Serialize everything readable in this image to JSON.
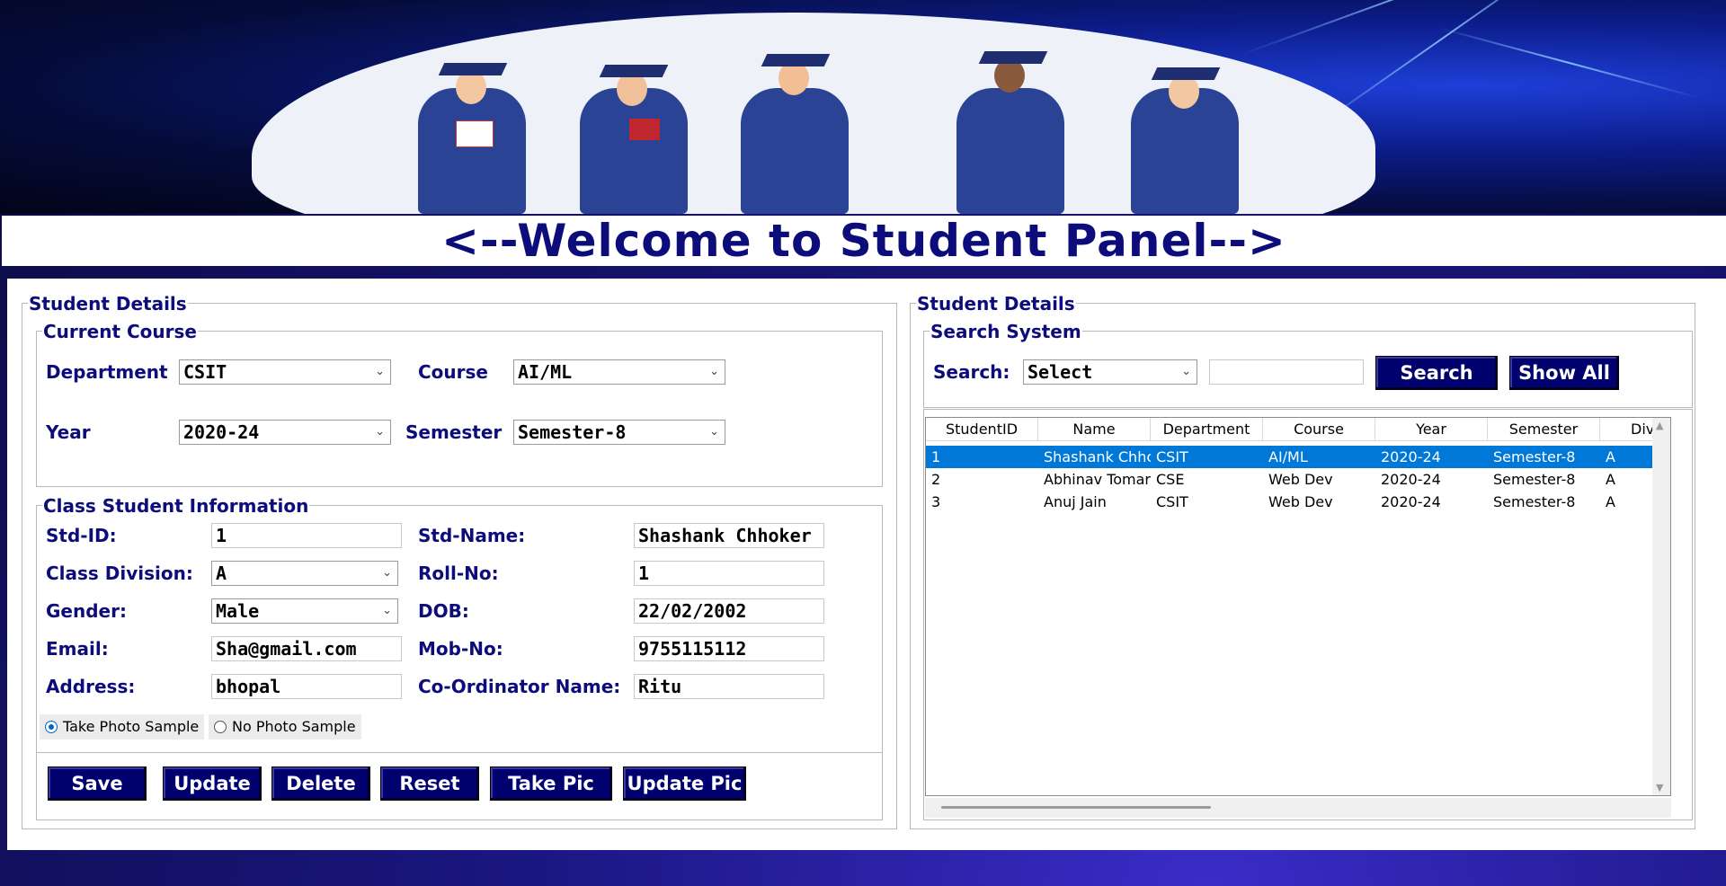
{
  "title": "<--Welcome to Student Panel-->",
  "left_panel": {
    "legend": "Student Details",
    "current_course": {
      "legend": "Current Course",
      "department_label": "Department",
      "department_value": "CSIT",
      "course_label": "Course",
      "course_value": "AI/ML",
      "year_label": "Year",
      "year_value": "2020-24",
      "semester_label": "Semester",
      "semester_value": "Semester-8"
    },
    "class_info": {
      "legend": "Class Student Information",
      "std_id_label": "Std-ID:",
      "std_id_value": "1",
      "std_name_label": "Std-Name:",
      "std_name_value": "Shashank Chhoker",
      "division_label": "Class Division:",
      "division_value": "A",
      "roll_label": "Roll-No:",
      "roll_value": "1",
      "gender_label": "Gender:",
      "gender_value": "Male",
      "dob_label": "DOB:",
      "dob_value": "22/02/2002",
      "email_label": "Email:",
      "email_value": "Sha@gmail.com",
      "mob_label": "Mob-No:",
      "mob_value": "9755115112",
      "address_label": "Address:",
      "address_value": "bhopal",
      "coordinator_label": "Co-Ordinator Name:",
      "coordinator_value": "Ritu",
      "radio_take": "Take Photo Sample",
      "radio_no": "No Photo Sample",
      "radio_selected": "Take Photo Sample"
    },
    "buttons": {
      "save": "Save",
      "update": "Update",
      "delete": "Delete",
      "reset": "Reset",
      "take_pic": "Take Pic",
      "update_pic": "Update Pic"
    }
  },
  "right_panel": {
    "legend": "Student Details",
    "search_system": {
      "legend": "Search System",
      "search_label": "Search:",
      "search_by_value": "Select",
      "search_text": "",
      "search_button": "Search",
      "show_all_button": "Show All"
    },
    "table": {
      "columns": [
        "StudentID",
        "Name",
        "Department",
        "Course",
        "Year",
        "Semester",
        "Divisic"
      ],
      "rows": [
        [
          "1",
          "Shashank Chhc",
          "CSIT",
          "AI/ML",
          "2020-24",
          "Semester-8",
          "A"
        ],
        [
          "2",
          "Abhinav Tomar",
          "CSE",
          "Web Dev",
          "2020-24",
          "Semester-8",
          "A"
        ],
        [
          "3",
          "Anuj Jain",
          "CSIT",
          "Web Dev",
          "2020-24",
          "Semester-8",
          "A"
        ]
      ],
      "selected_row": 0
    }
  },
  "colors": {
    "accent": "#0c0c7a",
    "button_bg": "#00006e",
    "selection": "#0078d7"
  }
}
